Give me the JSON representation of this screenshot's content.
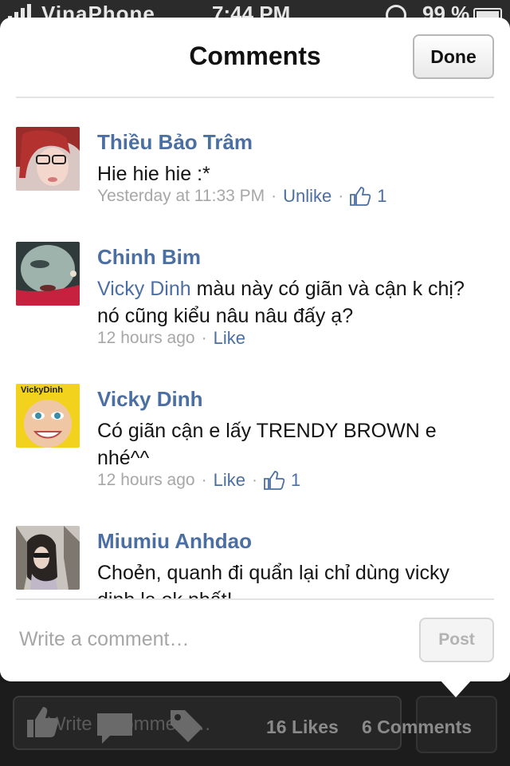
{
  "status_bar": {
    "carrier": "VinaPhone",
    "time": "7:44 PM",
    "battery": "99 %"
  },
  "popup": {
    "title": "Comments",
    "done_label": "Done"
  },
  "comments": [
    {
      "author": "Thiều Bảo Trâm",
      "mention": "",
      "text": "Hie hie hie :*",
      "time": "Yesterday at 11:33 PM",
      "action": "Unlike",
      "likes": "1"
    },
    {
      "author": "Chinh Bim",
      "mention": "Vicky Dinh",
      "text": " màu này có giãn và cận k chị? nó cũng kiểu nâu nâu đấy ạ?",
      "time": "12 hours ago",
      "action": "Like",
      "likes": ""
    },
    {
      "author": "Vicky Dinh",
      "mention": "",
      "text": "Có giãn cận e lấy TRENDY BROWN e nhé^^",
      "time": "12 hours ago",
      "action": "Like",
      "likes": "1"
    },
    {
      "author": "Miumiu Anhdao",
      "mention": "",
      "text": "Choẻn, quanh đi quẩn lại chỉ dùng vicky dinh la ok nhất!",
      "time": "",
      "action": "",
      "likes": ""
    }
  ],
  "avatar_labels": {
    "vicky_logo": "VickyDinh"
  },
  "composer": {
    "placeholder": "Write a comment…",
    "post_label": "Post"
  },
  "toolbar": {
    "placeholder": "Write a comment…",
    "likes_count": "16 Likes",
    "comments_count": "6 Comments"
  },
  "colors": {
    "link_blue": "#4b6ea3",
    "meta_gray": "#a7a7a7"
  }
}
